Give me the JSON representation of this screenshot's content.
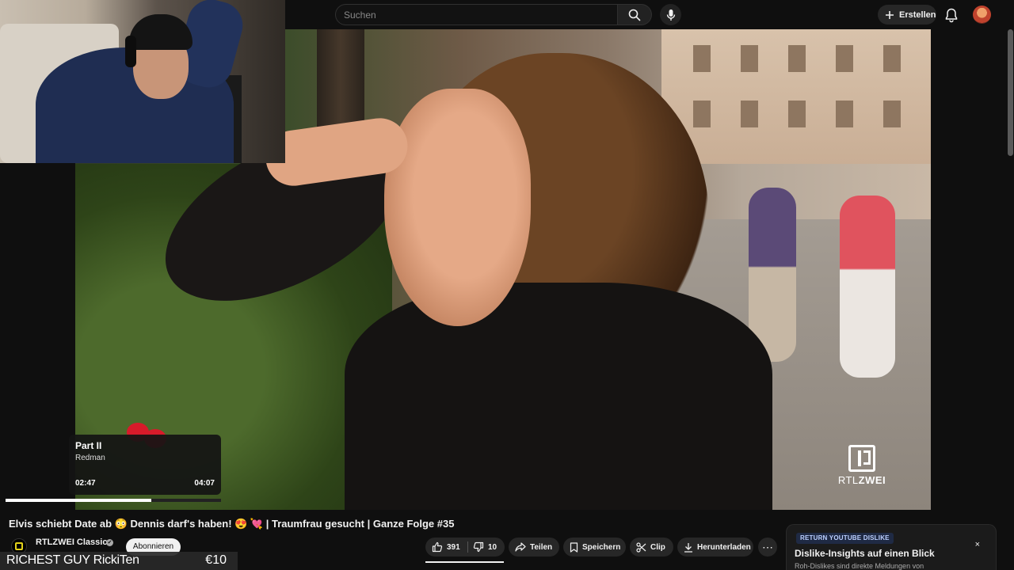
{
  "header": {
    "search": {
      "placeholder": "Suchen",
      "value": ""
    },
    "create_label": "Erstellen",
    "icons": {
      "search": "search-icon",
      "mic": "mic-icon",
      "create": "plus-icon",
      "notifications": "bell-icon",
      "avatar": "avatar"
    }
  },
  "video": {
    "watermark": {
      "prefix": "RTL",
      "suffix": "ZWEI"
    }
  },
  "music_widget": {
    "title": "Part II",
    "artist": "Redman",
    "time_current": "02:47",
    "time_total": "04:07",
    "progress": 0.676
  },
  "meta": {
    "title": "Elvis schiebt Date ab 😳 Dennis darf's haben! 😍 💘 | Traumfrau gesucht | Ganze Folge #35",
    "channel": "RTLZWEI Classics",
    "verified": "✔",
    "subscribe_label": "Abonnieren"
  },
  "actions": {
    "likes": "391",
    "dislikes": "10",
    "share": "Teilen",
    "save": "Speichern",
    "clip": "Clip",
    "download": "Herunterladen",
    "more": "⋯"
  },
  "donation": {
    "name": "RICHEST GUY RickiTen",
    "amount": "€10"
  },
  "ryd": {
    "badge": "RETURN YOUTUBE DISLIKE",
    "title": "Dislike-Insights auf einen Blick",
    "subtitle": "Roh-Dislikes sind direkte Meldungen von",
    "close": "×"
  },
  "colors": {
    "background": "#0f0f0f",
    "pill": "#272727",
    "accent_red": "#d81b2a",
    "rtl_yellow": "#e3d21a"
  }
}
